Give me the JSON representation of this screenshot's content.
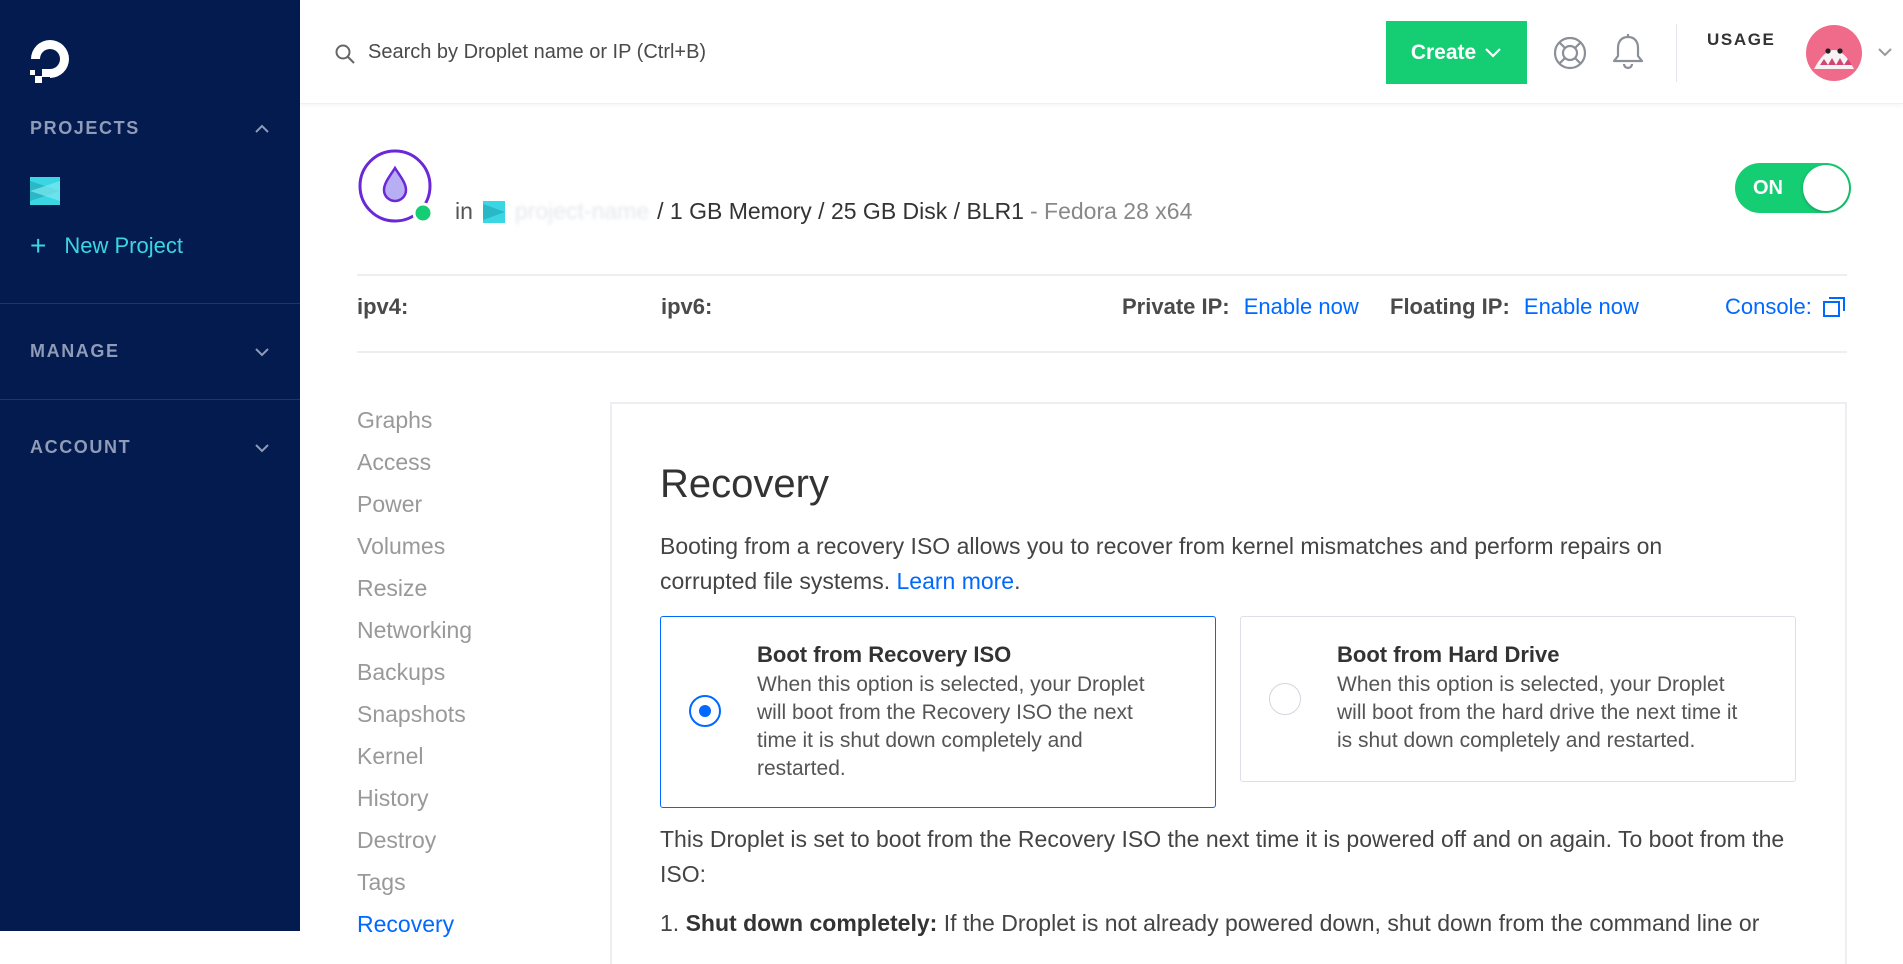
{
  "sidebar": {
    "projects_label": "PROJECTS",
    "new_project_label": "New Project",
    "manage_label": "MANAGE",
    "account_label": "ACCOUNT"
  },
  "header": {
    "search_placeholder": "Search by Droplet name or IP (Ctrl+B)",
    "create_label": "Create",
    "usage_label": "USAGE"
  },
  "droplet": {
    "in_label": "in",
    "project_name": "project-name",
    "specs": "/ 1 GB Memory / 25 GB Disk / BLR1",
    "os": "- Fedora 28 x64",
    "power_toggle_label": "ON"
  },
  "ip_row": {
    "ipv4_label": "ipv4:",
    "ipv6_label": "ipv6:",
    "private_ip_label": "Private IP:",
    "private_ip_action": "Enable now",
    "floating_ip_label": "Floating IP:",
    "floating_ip_action": "Enable now",
    "console_label": "Console:"
  },
  "subnav": {
    "items": [
      "Graphs",
      "Access",
      "Power",
      "Volumes",
      "Resize",
      "Networking",
      "Backups",
      "Snapshots",
      "Kernel",
      "History",
      "Destroy",
      "Tags",
      "Recovery"
    ],
    "active": "Recovery"
  },
  "recovery": {
    "title": "Recovery",
    "description": "Booting from a recovery ISO allows you to recover from kernel mismatches and perform repairs on corrupted file systems.",
    "learn_more": "Learn more",
    "learn_more_suffix": ".",
    "options": [
      {
        "title": "Boot from Recovery ISO",
        "body": "When this option is selected, your Droplet will boot from the Recovery ISO the next time it is shut down completely and restarted.",
        "selected": true
      },
      {
        "title": "Boot from Hard Drive",
        "body": "When this option is selected, your Droplet will boot from the hard drive the next time it is shut down completely and restarted.",
        "selected": false
      }
    ],
    "note": "This Droplet is set to boot from the Recovery ISO the next time it is powered off and on again. To boot from the ISO:",
    "step1_number": "1.",
    "step1_title": "Shut down completely:",
    "step1_text": "If the Droplet is not already powered down, shut down from the command line or"
  },
  "colors": {
    "sidebar_bg": "#031b4e",
    "accent_green": "#15cd72",
    "link_blue": "#0069ff",
    "teal": "#3bd6e4"
  }
}
